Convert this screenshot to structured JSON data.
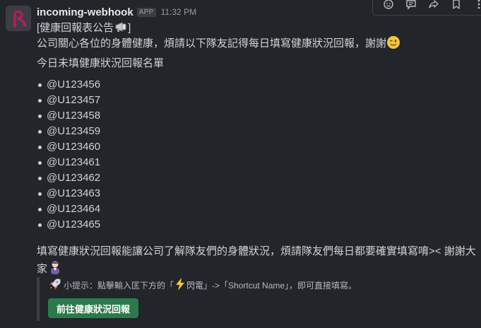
{
  "message": {
    "sender": "incoming-webhook",
    "badge": "APP",
    "time": "11:32 PM",
    "title": "[健康回報表公告",
    "title_close": "]",
    "intro": "公司關心各位的身體健康，煩請以下隊友記得每日填寫健康狀況回報，謝謝",
    "list_heading": "今日未填健康狀況回報名單",
    "users": [
      "@U123456",
      "@U123457",
      "@U123458",
      "@U123459",
      "@U123460",
      "@U123461",
      "@U123462",
      "@U123463",
      "@U123464",
      "@U123465"
    ],
    "outro": "填寫健康狀況回報能讓公司了解隊友們的身體狀況，煩請隊友們每日都要確實填寫唷>< 謝謝大家",
    "hint_prefix": "小提示：點擊輸入匡下方的「",
    "hint_mid": "閃電」->「Shortcut Name」，即可直接填寫。",
    "button_label": "前往健康狀況回報"
  },
  "colors": {
    "accent_button": "#2b7a4b",
    "background": "#222529",
    "text": "#d1d2d3"
  },
  "icons": {
    "toolbar": [
      "emoji-reaction-icon",
      "reply-thread-icon",
      "share-icon",
      "bookmark-icon",
      "more-icon"
    ],
    "inline": [
      "megaphone-icon",
      "winking-face-icon",
      "person-icon",
      "rocket-icon",
      "lightning-icon"
    ]
  }
}
